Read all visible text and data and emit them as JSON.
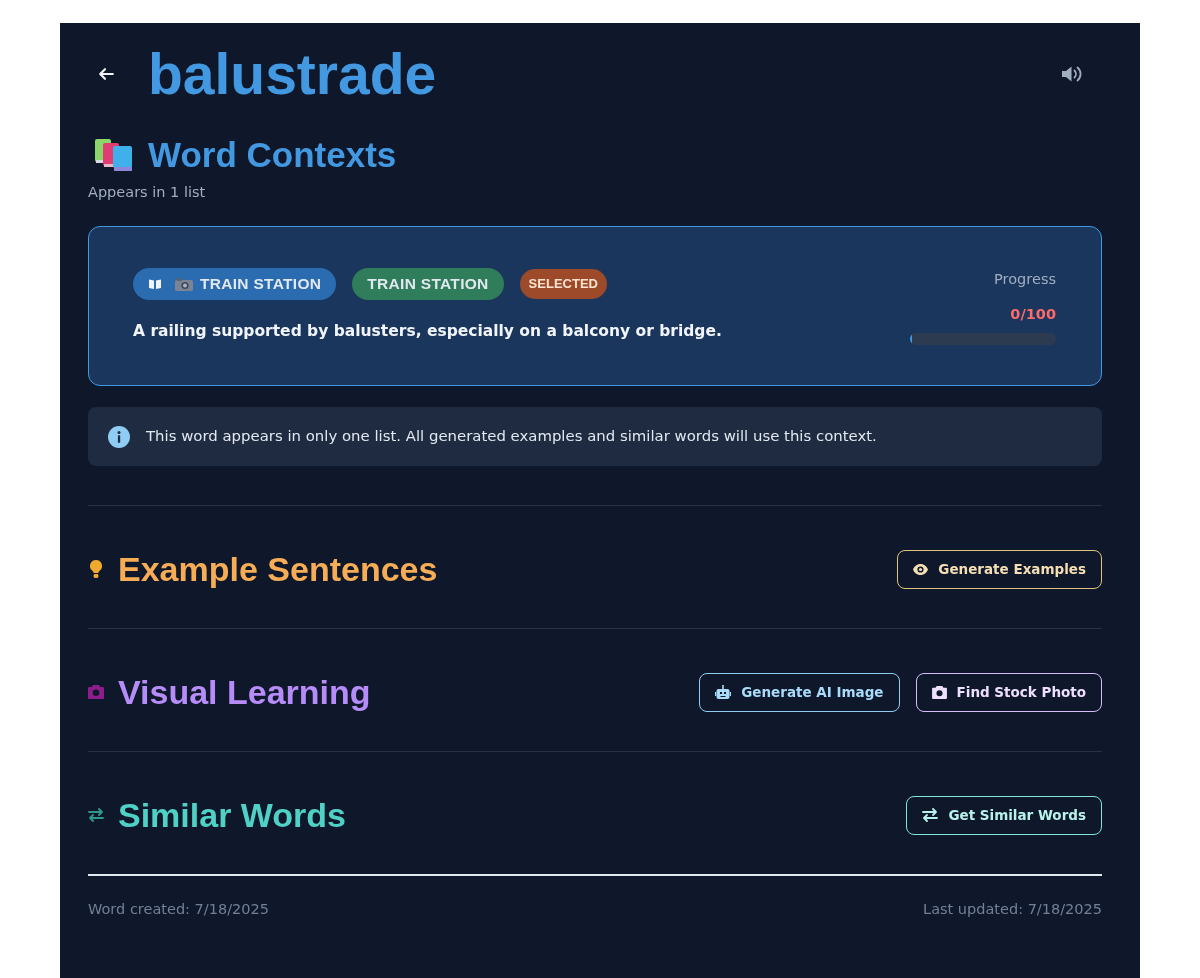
{
  "header": {
    "title": "balustrade"
  },
  "contexts": {
    "heading": "Word Contexts",
    "subtitle": "Appears in 1 list",
    "items": [
      {
        "selected": true,
        "tags": [
          {
            "kind": "list",
            "text": "TRAIN STATION"
          },
          {
            "kind": "category",
            "text": "TRAIN STATION"
          },
          {
            "kind": "status",
            "text": "SELECTED"
          }
        ],
        "definition": "A railing supported by balusters, especially on a balcony or bridge.",
        "progress": {
          "label": "Progress",
          "reading": "0/100",
          "level": 0
        }
      }
    ]
  },
  "notice": {
    "text": "This word appears in only one list. All generated examples and similar words will use this context."
  },
  "sections": [
    {
      "kind": "examples",
      "title": "Example Sentences",
      "buttons": [
        {
          "kind": "examples",
          "label": "Generate Examples"
        }
      ]
    },
    {
      "kind": "visual",
      "title": "Visual Learning",
      "buttons": [
        {
          "kind": "ai_image",
          "label": "Generate AI Image"
        },
        {
          "kind": "stock_photo",
          "label": "Find Stock Photo"
        }
      ]
    },
    {
      "kind": "similar",
      "title": "Similar Words",
      "buttons": [
        {
          "kind": "similar",
          "label": "Get Similar Words"
        }
      ]
    }
  ],
  "footer": {
    "created": "Word created: 7/18/2025",
    "updated": "Last updated: 7/18/2025"
  }
}
